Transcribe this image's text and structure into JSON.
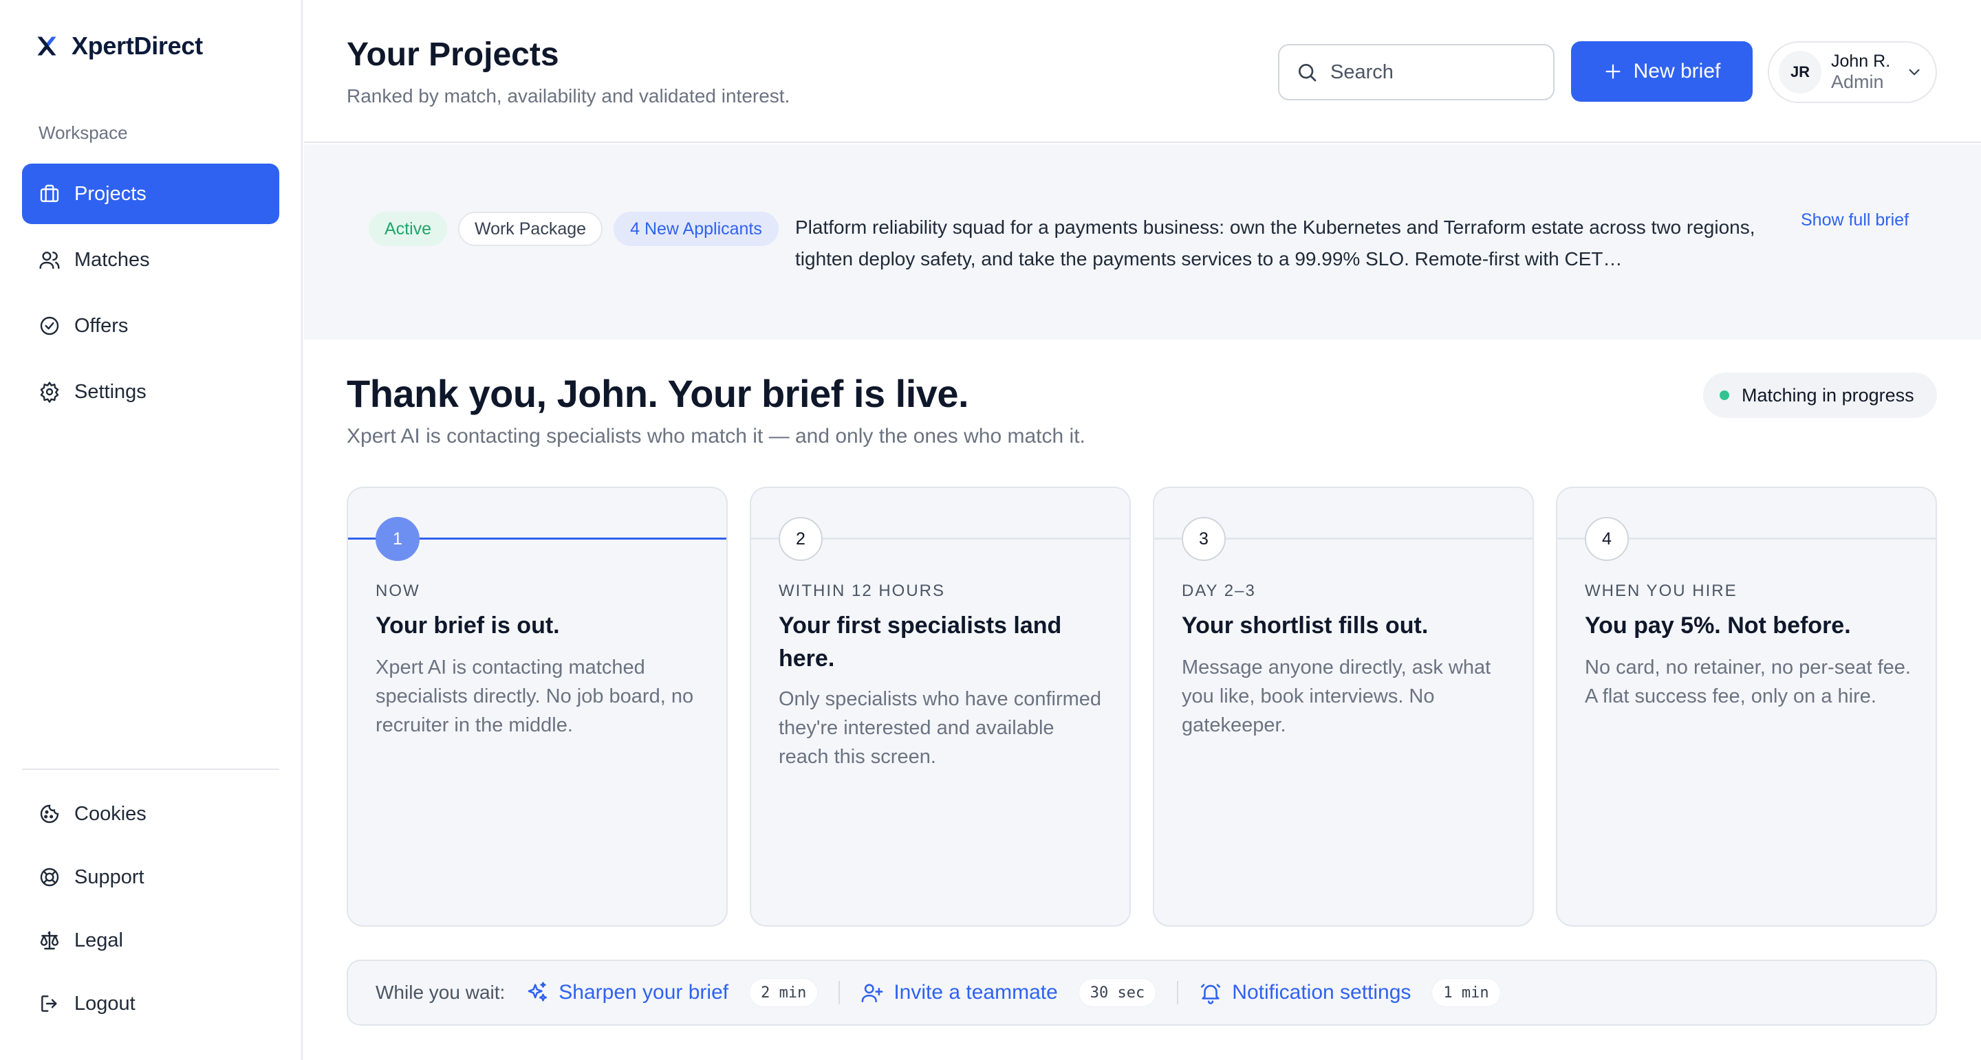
{
  "brand": {
    "name": "XpertDirect"
  },
  "sidebar": {
    "section_label": "Workspace",
    "items": [
      {
        "label": "Projects",
        "icon": "briefcase-icon",
        "active": true
      },
      {
        "label": "Matches",
        "icon": "users-icon",
        "active": false
      },
      {
        "label": "Offers",
        "icon": "check-circle-icon",
        "active": false
      },
      {
        "label": "Settings",
        "icon": "gear-icon",
        "active": false
      }
    ],
    "bottom_items": [
      {
        "label": "Cookies",
        "icon": "cookie-icon"
      },
      {
        "label": "Support",
        "icon": "lifebuoy-icon"
      },
      {
        "label": "Legal",
        "icon": "scale-icon"
      },
      {
        "label": "Logout",
        "icon": "logout-icon"
      }
    ]
  },
  "header": {
    "title": "Your Projects",
    "subtitle": "Ranked by match, availability and validated interest.",
    "search_placeholder": "Search",
    "new_brief_label": "New brief",
    "user": {
      "initials": "JR",
      "name": "John R.",
      "role": "Admin"
    }
  },
  "brief": {
    "badges": {
      "status": "Active",
      "type": "Work Package",
      "applicants": "4 New Applicants"
    },
    "text": "Platform reliability squad for a payments business: own the Kubernetes and Terraform estate across two regions, tighten deploy safety, and take the payments services to a 99.99% SLO. Remote-first with CET…",
    "show_full_label": "Show full brief"
  },
  "main": {
    "title": "Thank you, John. Your brief is live.",
    "subtitle": "Xpert AI is contacting specialists who match it — and only the ones who match it.",
    "status": "Matching in progress",
    "status_color": "#34c38f",
    "accent": "#2f62f0",
    "steps": [
      {
        "num": "1",
        "label": "NOW",
        "title": "Your brief is out.",
        "desc": "Xpert AI is contacting matched specialists directly. No job board, no recruiter in the middle."
      },
      {
        "num": "2",
        "label": "WITHIN 12 HOURS",
        "title": "Your first specialists land here.",
        "desc": "Only specialists who have confirmed they're interested and available reach this screen."
      },
      {
        "num": "3",
        "label": "DAY 2–3",
        "title": "Your shortlist fills out.",
        "desc": "Message anyone directly, ask what you like, book interviews. No gatekeeper."
      },
      {
        "num": "4",
        "label": "WHEN YOU HIRE",
        "title": "You pay 5%. Not before.",
        "desc": "No card, no retainer, no per-seat fee. A flat success fee, only on a hire."
      }
    ]
  },
  "wait": {
    "label": "While you wait:",
    "actions": [
      {
        "label": "Sharpen your brief",
        "time": "2 min",
        "icon": "sparkles-icon"
      },
      {
        "label": "Invite a teammate",
        "time": "30 sec",
        "icon": "user-plus-icon"
      },
      {
        "label": "Notification settings",
        "time": "1 min",
        "icon": "bell-icon"
      }
    ]
  }
}
